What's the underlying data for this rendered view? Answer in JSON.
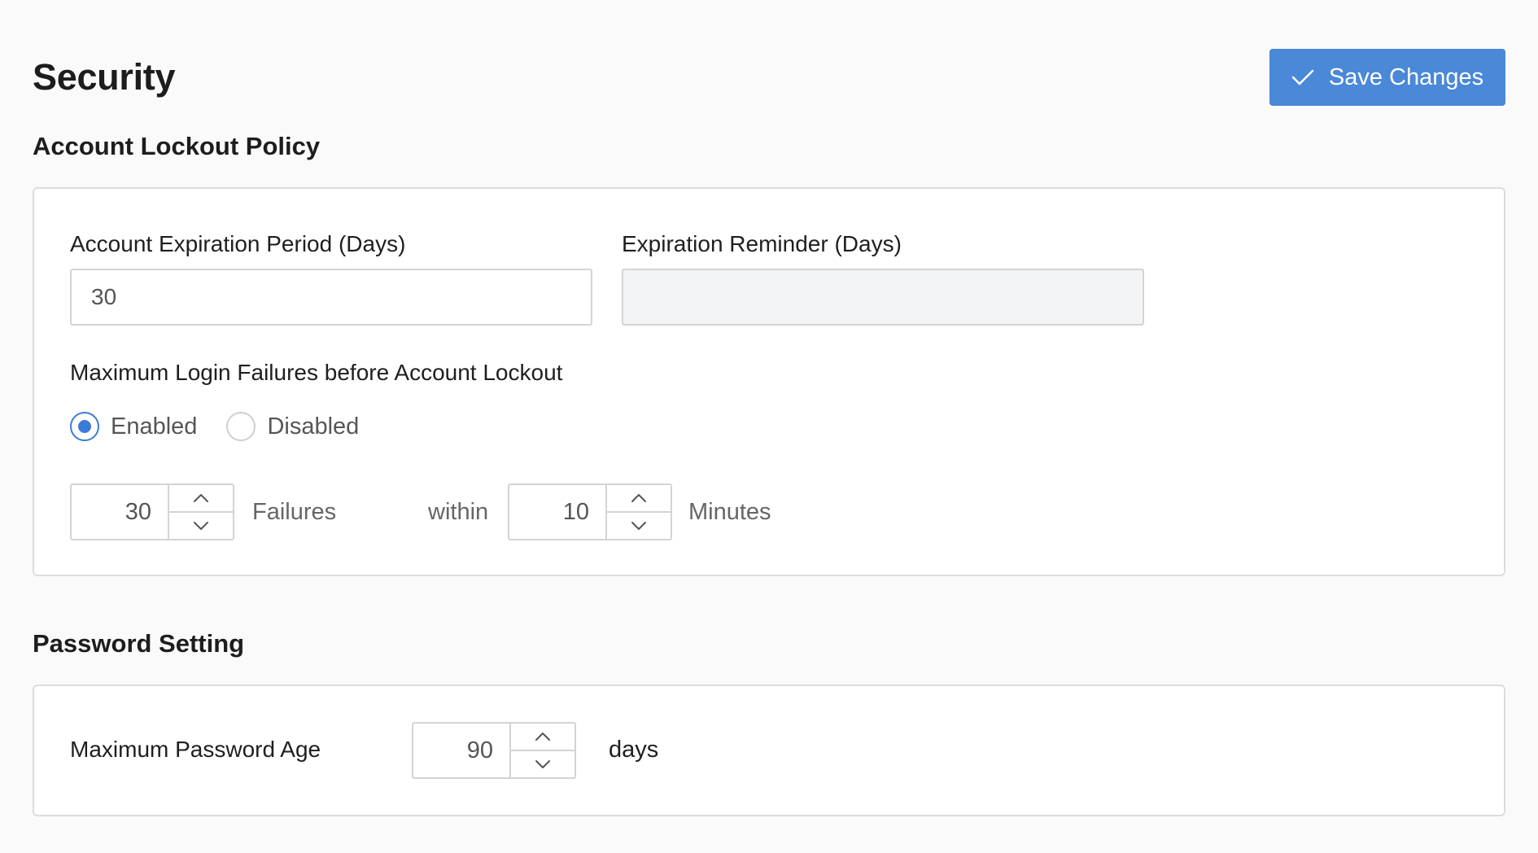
{
  "header": {
    "title": "Security",
    "save_label": "Save Changes"
  },
  "lockout": {
    "section_title": "Account Lockout Policy",
    "expiration_period": {
      "label": "Account Expiration Period (Days)",
      "value": "30"
    },
    "expiration_reminder": {
      "label": "Expiration Reminder (Days)",
      "value": ""
    },
    "max_failures": {
      "label": "Maximum Login Failures before Account Lockout",
      "options": [
        "Enabled",
        "Disabled"
      ],
      "selected": "Enabled",
      "failures_value": "30",
      "failures_unit": "Failures",
      "within_label": "within",
      "minutes_value": "10",
      "minutes_unit": "Minutes"
    }
  },
  "password": {
    "section_title": "Password Setting",
    "max_age": {
      "label": "Maximum Password Age",
      "value": "90",
      "unit": "days"
    }
  },
  "colors": {
    "accent": "#4a88d8",
    "radio_selected": "#3b7bd6",
    "background": "#fafafa",
    "panel_border": "#dcdcdc",
    "disabled_input": "#f3f4f6"
  }
}
